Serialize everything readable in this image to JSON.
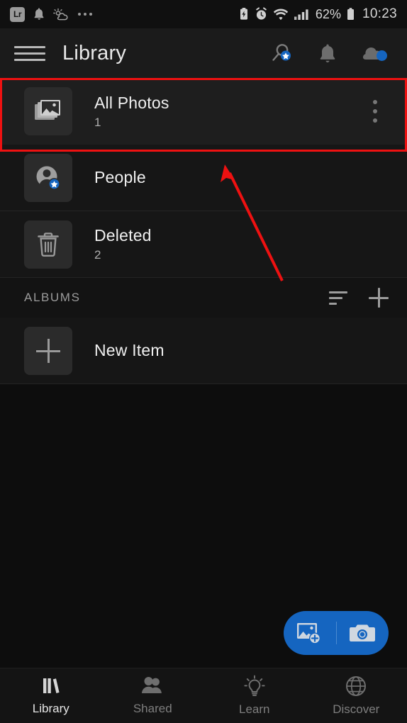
{
  "statusbar": {
    "app_badge": "Lr",
    "left_icons": [
      "bell-icon",
      "weather-icon",
      "more-dots-icon"
    ],
    "right_icons": [
      "battery-saver-icon",
      "alarm-icon",
      "wifi-icon",
      "signal-icon"
    ],
    "battery_percent": "62%",
    "time": "10:23"
  },
  "appbar": {
    "menu_icon": "hamburger-menu-icon",
    "title": "Library",
    "actions": [
      {
        "name": "search-icon",
        "badge": "star"
      },
      {
        "name": "notifications-bell-icon",
        "badge": null
      },
      {
        "name": "cloud-sync-icon",
        "badge": "dot"
      }
    ]
  },
  "annotation": {
    "highlight_color": "#ee1111",
    "arrow_color": "#ee1111",
    "target": "All Photos row"
  },
  "library_rows": [
    {
      "icon": "photos-stack-icon",
      "title": "All Photos",
      "count": "1",
      "has_overflow": true,
      "highlighted": true
    },
    {
      "icon": "people-star-icon",
      "title": "People",
      "count": "",
      "has_overflow": false,
      "highlighted": false
    },
    {
      "icon": "trash-icon",
      "title": "Deleted",
      "count": "2",
      "has_overflow": false,
      "highlighted": false
    }
  ],
  "albums": {
    "header": "ALBUMS",
    "sort_icon": "sort-lines-icon",
    "add_icon": "plus-icon",
    "items": [
      {
        "icon": "plus-icon",
        "title": "New Item"
      }
    ]
  },
  "fab": {
    "color": "#1565c0",
    "actions": [
      {
        "name": "add-photo-icon"
      },
      {
        "name": "camera-icon"
      }
    ]
  },
  "bottom_nav": {
    "items": [
      {
        "label": "Library",
        "icon": "books-icon",
        "active": true
      },
      {
        "label": "Shared",
        "icon": "people-icon",
        "active": false
      },
      {
        "label": "Learn",
        "icon": "lightbulb-icon",
        "active": false
      },
      {
        "label": "Discover",
        "icon": "globe-icon",
        "active": false
      }
    ]
  }
}
